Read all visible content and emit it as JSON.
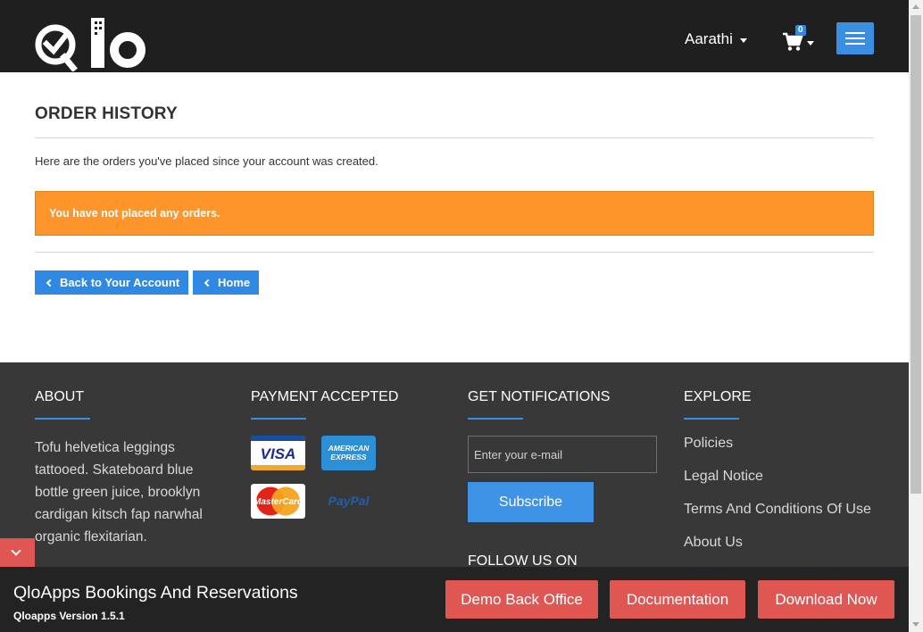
{
  "header": {
    "logo_text": "Qlo",
    "user_name": "Aarathi",
    "cart_count": "0",
    "colors": {
      "background": "#1f1f1f",
      "accent": "#3b8fe3"
    }
  },
  "main": {
    "title": "ORDER HISTORY",
    "intro": "Here are the orders you've placed since your account was created.",
    "alert": "You have not placed any orders.",
    "back_button": "Back to Your Account",
    "home_button": "Home",
    "colors": {
      "alert": "#fd952a",
      "button": "#2f89e2"
    }
  },
  "footer": {
    "about": {
      "heading": "ABOUT",
      "text": "Tofu helvetica leggings tattooed. Skateboard blue bottle green juice, brooklyn cardigan kitsch fap narwhal organic flexitarian."
    },
    "payment": {
      "heading": "PAYMENT ACCEPTED",
      "cards": [
        {
          "icon": "visa-card-icon",
          "label": "VISA"
        },
        {
          "icon": "amex-card-icon",
          "label": "AMERICAN EXPRESS"
        },
        {
          "icon": "mastercard-icon",
          "label": "MasterCard"
        },
        {
          "icon": "paypal-icon",
          "label": "PayPal"
        }
      ]
    },
    "notifications": {
      "heading": "GET NOTIFICATIONS",
      "email_placeholder": "Enter your e-mail",
      "subscribe_label": "Subscribe",
      "follow_heading": "FOLLOW US ON"
    },
    "explore": {
      "heading": "EXPLORE",
      "links": [
        "Policies",
        "Legal Notice",
        "Terms And Conditions Of Use",
        "About Us"
      ]
    }
  },
  "bottom_bar": {
    "title": "QloApps Bookings And Reservations",
    "version": "Qloapps Version 1.5.1",
    "buttons": [
      "Demo Back Office",
      "Documentation",
      "Download Now"
    ],
    "button_color": "#e05653"
  }
}
